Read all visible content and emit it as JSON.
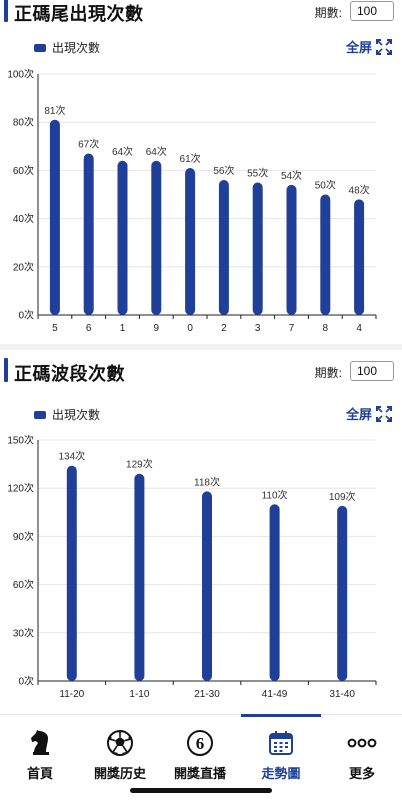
{
  "colors": {
    "accent": "#1f3f99",
    "grid": "#e6e6e6",
    "axis": "#222222"
  },
  "sections": [
    {
      "title": "正碼尾出現次數",
      "period_label": "期數:",
      "period_value": "100",
      "legend_label": "出現次數",
      "fullscreen_label": "全屏",
      "fullscreen_icon": "expand-icon"
    },
    {
      "title": "正碼波段次數",
      "period_label": "期數:",
      "period_value": "100",
      "legend_label": "出現次數",
      "fullscreen_label": "全屏",
      "fullscreen_icon": "expand-icon"
    }
  ],
  "chart_data": [
    {
      "type": "bar",
      "categories": [
        "5",
        "6",
        "1",
        "9",
        "0",
        "2",
        "3",
        "7",
        "8",
        "4"
      ],
      "values": [
        81,
        67,
        64,
        64,
        61,
        56,
        55,
        54,
        50,
        48
      ],
      "value_suffix": "次",
      "ylim": [
        0,
        100
      ],
      "yticks": [
        0,
        20,
        40,
        60,
        80,
        100
      ],
      "ytick_labels": [
        "0次",
        "20次",
        "40次",
        "60次",
        "80次",
        "100次"
      ],
      "legend": [
        "出現次數"
      ],
      "grid": true
    },
    {
      "type": "bar",
      "categories": [
        "11-20",
        "1-10",
        "21-30",
        "41-49",
        "31-40"
      ],
      "values": [
        134,
        129,
        118,
        110,
        109
      ],
      "value_suffix": "次",
      "ylim": [
        0,
        150
      ],
      "yticks": [
        0,
        30,
        60,
        90,
        120,
        150
      ],
      "ytick_labels": [
        "0次",
        "30次",
        "60次",
        "90次",
        "120次",
        "150次"
      ],
      "legend": [
        "出現次數"
      ],
      "grid": true
    }
  ],
  "tabbar": {
    "items": [
      {
        "label": "首頁",
        "icon": "knight-icon"
      },
      {
        "label": "開獎历史",
        "icon": "soccer-ball-icon"
      },
      {
        "label": "開獎直播",
        "icon": "number-six-icon",
        "glyph": "6"
      },
      {
        "label": "走勢圖",
        "icon": "calendar-icon"
      },
      {
        "label": "更多",
        "icon": "more-dots-icon"
      }
    ],
    "active_index": 3
  }
}
